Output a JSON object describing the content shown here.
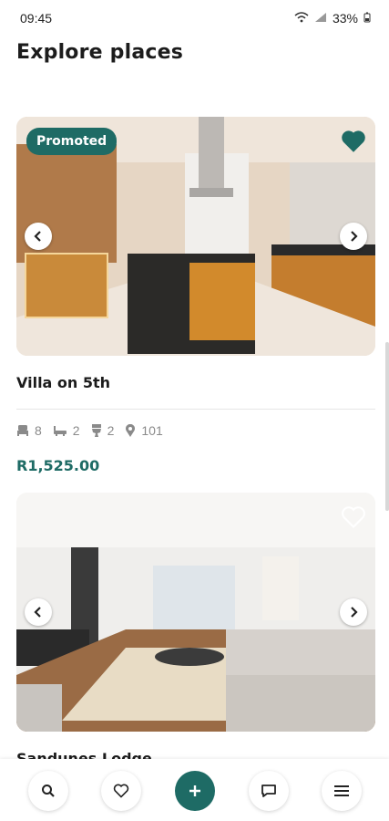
{
  "status": {
    "time": "09:45",
    "battery": "33%"
  },
  "page": {
    "title": "Explore places"
  },
  "listings": [
    {
      "badge": "Promoted",
      "name": "Villa on 5th",
      "bedrooms": "8",
      "bathrooms": "2",
      "toilets": "2",
      "location": "101",
      "price": "R1,525.00",
      "favorited": true
    },
    {
      "name": "Sandunes Lodge",
      "favorited": false
    }
  ],
  "icons": {
    "prev": "chevron-left-icon",
    "next": "chevron-right-icon",
    "favorite": "heart-icon",
    "bed": "bed-icon",
    "bath": "bath-icon",
    "toilet": "toilet-icon",
    "location": "location-pin-icon"
  },
  "bottom_nav": [
    "search-icon",
    "heart-icon",
    "plus-icon",
    "chat-icon",
    "menu-icon"
  ],
  "colors": {
    "accent": "#1e6b65",
    "muted": "#8a8a8a"
  }
}
